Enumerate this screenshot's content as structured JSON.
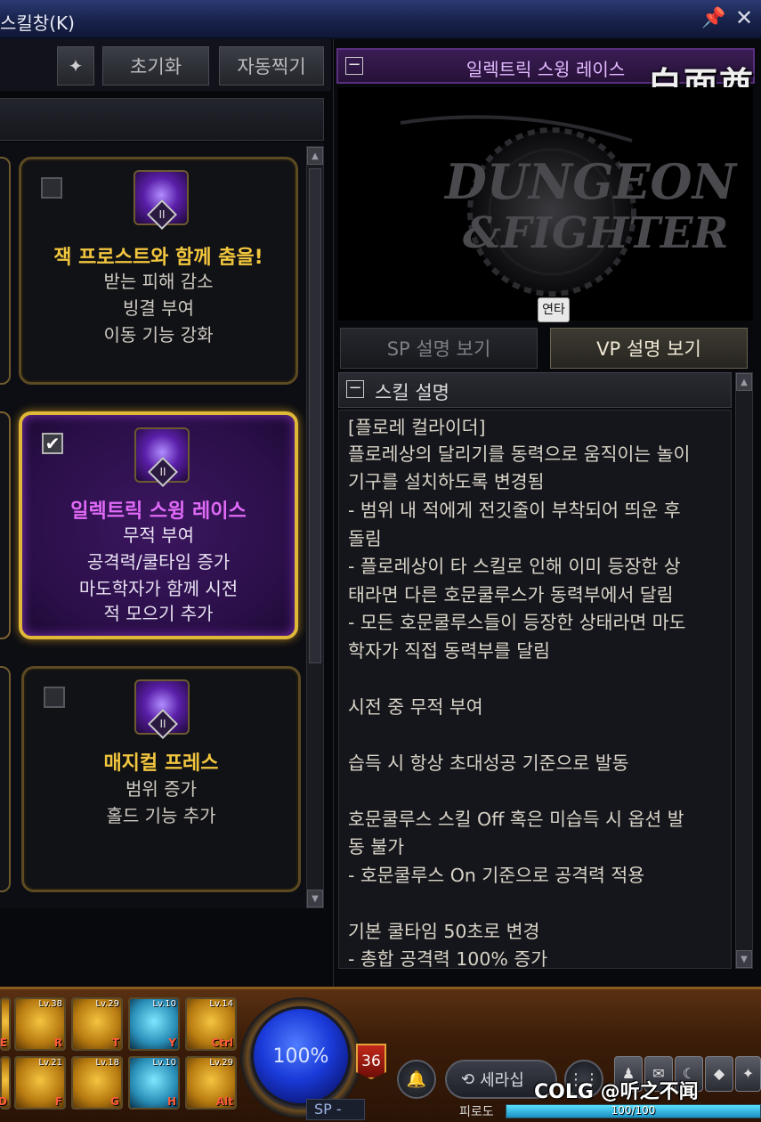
{
  "window": {
    "title": "스킬창(K)",
    "pin_icon": "pin-icon",
    "close_icon": "close-icon"
  },
  "toolbar": {
    "sp_icon": "skill-tree-icon",
    "reset_label": "초기화",
    "auto_label": "자동찍기"
  },
  "skills": [
    {
      "name": "잭 프로스트와 함께 춤을!",
      "rank": "II",
      "checked": false,
      "desc": [
        "받는 피해 감소",
        "빙결 부여",
        "이동 기능 강화"
      ]
    },
    {
      "name": "일렉트릭 스윙 레이스",
      "rank": "II",
      "checked": true,
      "desc": [
        "무적 부여",
        "공격력/쿨타임 증가",
        "마도학자가 함께 시전",
        "적 모으기 추가"
      ]
    },
    {
      "name": "매지컬 프레스",
      "rank": "II",
      "checked": false,
      "desc": [
        "범위 증가",
        "홀드 기능 추가"
      ]
    }
  ],
  "detail": {
    "header_title": "일렉트릭 스윙 레이스",
    "combo_badge": "연타",
    "tabs": [
      {
        "label": "SP 설명 보기",
        "active": false
      },
      {
        "label": "VP 설명 보기",
        "active": true
      }
    ],
    "desc_header": "스킬 설명",
    "desc_lines": [
      "[플로레 컬라이더]",
      "플로레상의 달리기를 동력으로 움직이는 놀이",
      "기구를 설치하도록 변경됨",
      "- 범위 내 적에게 전깃줄이 부착되어 띄운 후",
      "돌림",
      "- 플로레상이 타 스킬로 인해 이미 등장한 상",
      "태라면 다른 호문쿨루스가 동력부에서 달림",
      "- 모든 호문쿨루스들이 등장한 상태라면 마도",
      "학자가 직접 동력부를 달림",
      "",
      "시전 중 무적 부여",
      "",
      "습득 시 항상 초대성공 기준으로 발동",
      "",
      "호문쿨루스 스킬 Off 혹은 미습득 시 옵션 발",
      "동 불가",
      "- 호문쿨루스 On 기준으로 공격력 적용",
      "",
      "기본 쿨타임 50초로 변경",
      "- 총합 공격력 100% 증가"
    ]
  },
  "hud": {
    "slots_row1": [
      {
        "lv": "Lv.38",
        "key": "R"
      },
      {
        "lv": "Lv.29",
        "key": "T"
      },
      {
        "lv": "Lv.10",
        "key": "Y"
      },
      {
        "lv": "Lv.14",
        "key": "Ctrl"
      }
    ],
    "slots_row2": [
      {
        "lv": "Lv.21",
        "key": "F"
      },
      {
        "lv": "Lv.18",
        "key": "G"
      },
      {
        "lv": "Lv.10",
        "key": "H"
      },
      {
        "lv": "Lv.29",
        "key": "Alt"
      }
    ],
    "edge_keys": [
      "E",
      "D"
    ],
    "mp_percent_text": "100%",
    "sp_label": "SP -",
    "level": "36",
    "select_label": "세라십",
    "fatigue_label": "피로도",
    "fatigue_text": "100/100",
    "fatigue_fraction": 1.0
  },
  "watermarks": {
    "top": "白面酋",
    "bottom": "COLG @听之不闻"
  },
  "colors": {
    "accent_gold": "#e0b838",
    "accent_purple": "#e06af6",
    "skill_name_gold": "#f2c63e"
  }
}
